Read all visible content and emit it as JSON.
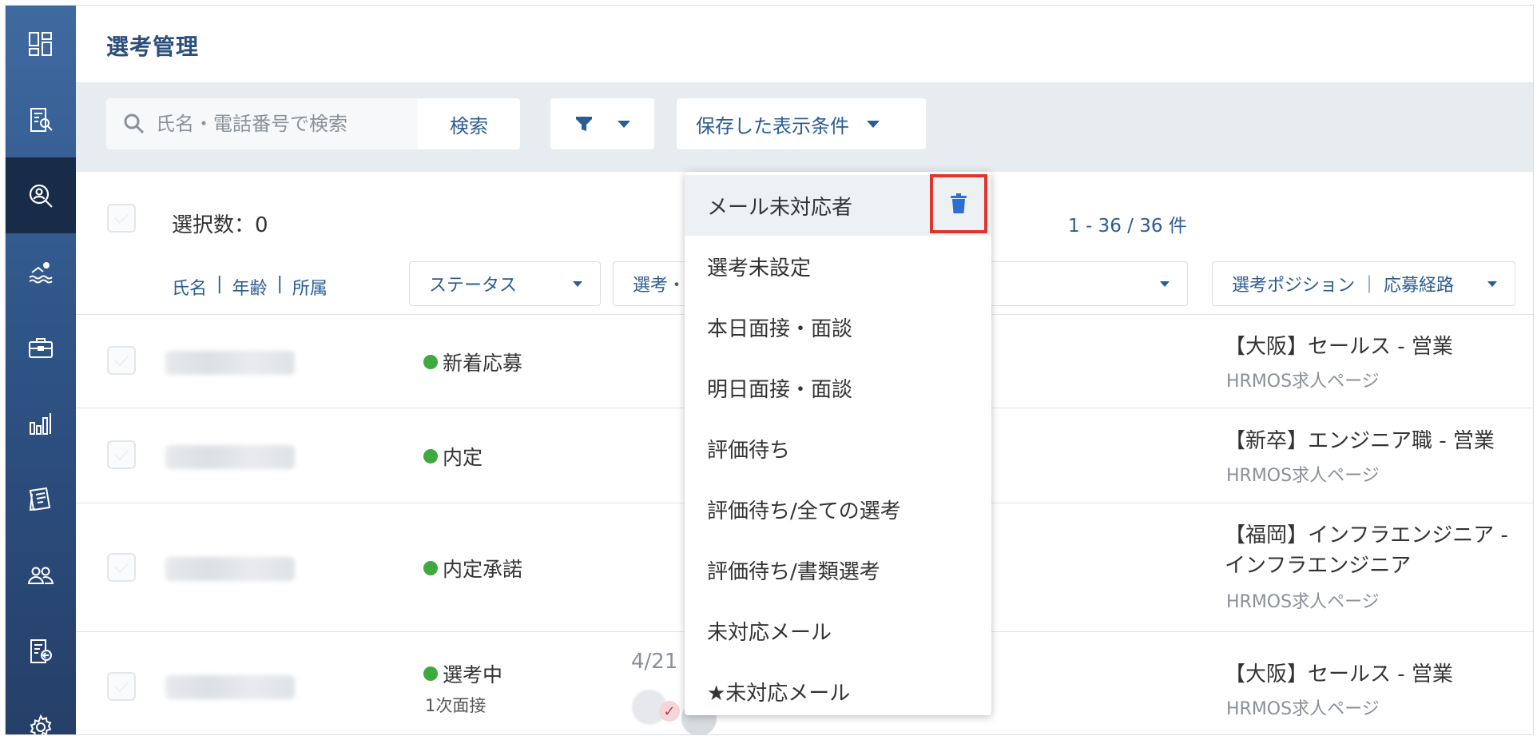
{
  "page": {
    "title": "選考管理"
  },
  "sidebar": {
    "items": [
      {
        "icon": "dashboard-icon",
        "active": false
      },
      {
        "icon": "document-search-icon",
        "active": false
      },
      {
        "icon": "candidate-search-icon",
        "active": true
      },
      {
        "icon": "swimmer-icon",
        "active": false
      },
      {
        "icon": "briefcase-icon",
        "active": false
      },
      {
        "icon": "bar-chart-icon",
        "active": false
      },
      {
        "icon": "documents-icon",
        "active": false
      },
      {
        "icon": "users-icon",
        "active": false
      },
      {
        "icon": "document-export-icon",
        "active": false
      },
      {
        "icon": "gear-icon",
        "active": false
      }
    ]
  },
  "toolbar": {
    "search_placeholder": "氏名・電話番号で検索",
    "search_button": "検索",
    "saved_conditions": "保存した表示条件"
  },
  "selection": {
    "label": "選択数：0",
    "pager": "1 - 36 / 36 件"
  },
  "columns": {
    "name": "氏名",
    "age": "年齢",
    "affiliation": "所属",
    "separator": "|",
    "status": "ステータス",
    "selection_partial": "選考・",
    "position": "選考ポジション ｜ 応募経路"
  },
  "rows": [
    {
      "status": "新着応募",
      "substatus": "",
      "position": "【大阪】セールス - 営業",
      "source": "HRMOS求人ページ"
    },
    {
      "status": "内定",
      "substatus": "",
      "position": "【新卒】エンジニア職 - 営業",
      "source": "HRMOS求人ページ"
    },
    {
      "status": "内定承諾",
      "substatus": "",
      "position_line1": "【福岡】インフラエンジニア -",
      "position_line2": "インフラエンジニア",
      "source": "HRMOS求人ページ"
    },
    {
      "status": "選考中",
      "substatus": "1次面接",
      "date": "4/21",
      "position": "【大阪】セールス - 営業",
      "source": "HRMOS求人ページ"
    }
  ],
  "dropdown": {
    "items": [
      "メール未対応者",
      "選考未設定",
      "本日面接・面談",
      "明日面接・面談",
      "評価待ち",
      "評価待ち/全ての選考",
      "評価待ち/書類選考",
      "未対応メール",
      "★未対応メール"
    ],
    "delete_icon": "trash-icon"
  },
  "colors": {
    "brand": "#2b5c94",
    "status_green": "#3daa3d",
    "highlight_red": "#e0352b"
  }
}
